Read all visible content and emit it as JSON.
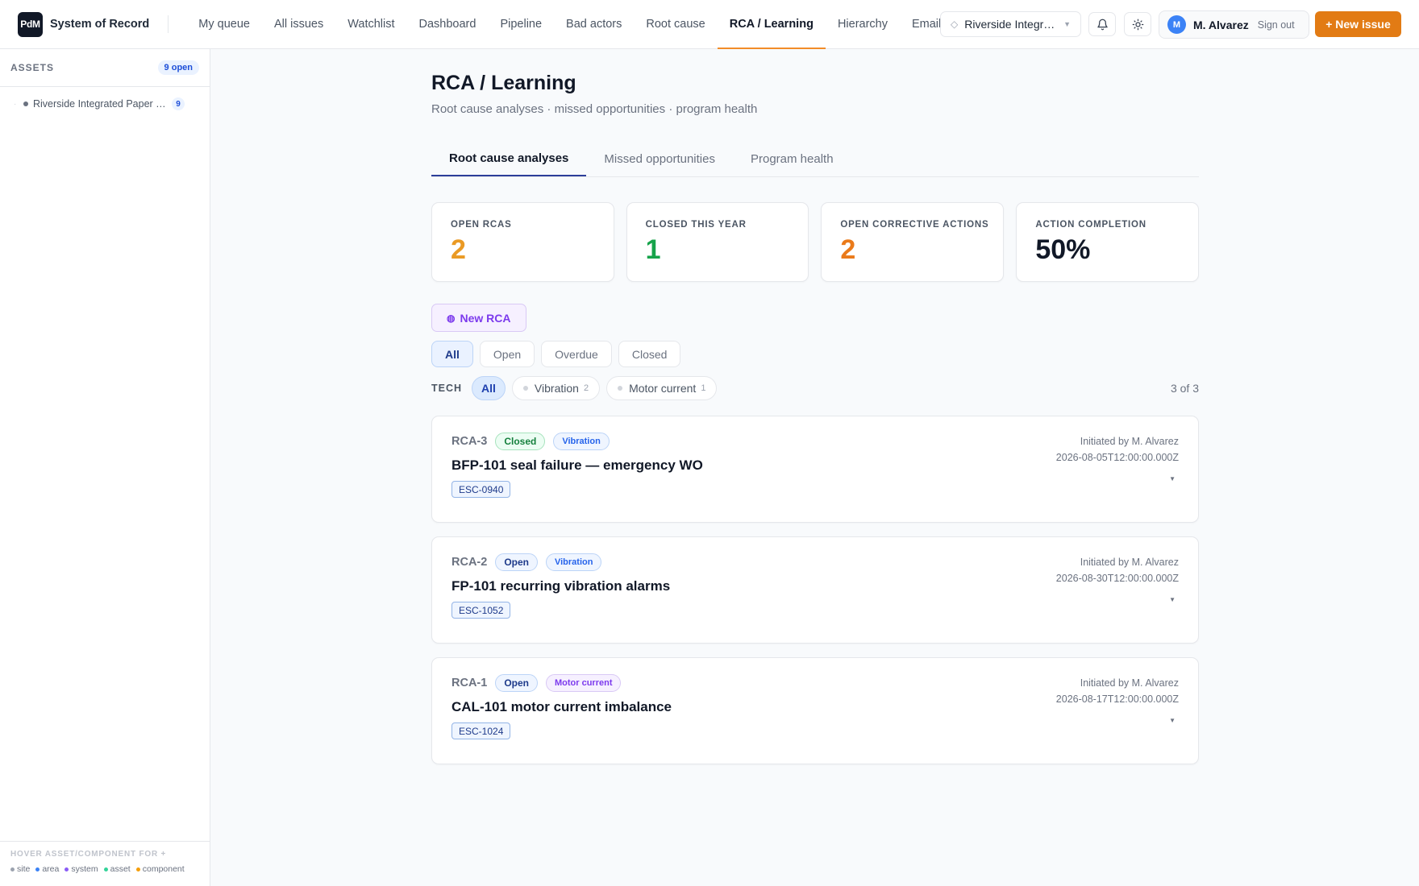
{
  "app": {
    "logo_text": "PdM",
    "name": "System of Record"
  },
  "nav": {
    "items": [
      {
        "label": "My queue"
      },
      {
        "label": "All issues"
      },
      {
        "label": "Watchlist"
      },
      {
        "label": "Dashboard"
      },
      {
        "label": "Pipeline"
      },
      {
        "label": "Bad actors"
      },
      {
        "label": "Root cause"
      },
      {
        "label": "RCA / Learning",
        "active": true
      },
      {
        "label": "Hierarchy"
      },
      {
        "label": "Email"
      }
    ]
  },
  "header": {
    "site_selector": "Riverside Integrated Paper",
    "bell_icon": "bell-icon",
    "theme_icon": "sun-icon",
    "user": {
      "initial": "M",
      "name": "M. Alvarez",
      "sign_out": "Sign out"
    },
    "new_issue": "+ New issue"
  },
  "sidebar": {
    "title": "ASSETS",
    "open_badge": "9 open",
    "items": [
      {
        "label": "Riverside Integrated Paper Mill",
        "count": "9"
      }
    ],
    "hint": "HOVER ASSET/COMPONENT FOR +",
    "legend": [
      {
        "label": "site",
        "color": "#9ca3af"
      },
      {
        "label": "area",
        "color": "#3b82f6"
      },
      {
        "label": "system",
        "color": "#8b5cf6"
      },
      {
        "label": "asset",
        "color": "#34d399"
      },
      {
        "label": "component",
        "color": "#f59e0b"
      }
    ]
  },
  "page": {
    "title": "RCA / Learning",
    "subtitle": "Root cause analyses · missed opportunities · program health",
    "tabs": [
      {
        "label": "Root cause analyses",
        "active": true
      },
      {
        "label": "Missed opportunities"
      },
      {
        "label": "Program health"
      }
    ]
  },
  "stats": [
    {
      "label": "OPEN RCAS",
      "value": "2",
      "color": "#ea9a24"
    },
    {
      "label": "CLOSED THIS YEAR",
      "value": "1",
      "color": "#16a34a"
    },
    {
      "label": "OPEN CORRECTIVE ACTIONS",
      "value": "2",
      "color": "#ea7a1a"
    },
    {
      "label": "ACTION COMPLETION",
      "value": "50%",
      "color": "#111827"
    }
  ],
  "new_rca": "New RCA",
  "status_filters": [
    {
      "label": "All",
      "active": true
    },
    {
      "label": "Open"
    },
    {
      "label": "Overdue"
    },
    {
      "label": "Closed"
    }
  ],
  "tech": {
    "label": "TECH",
    "chips": [
      {
        "label": "All",
        "active": true
      },
      {
        "label": "Vibration",
        "count": "2"
      },
      {
        "label": "Motor current",
        "count": "1"
      }
    ],
    "result_count": "3 of 3"
  },
  "rcas": [
    {
      "id": "RCA-3",
      "status": "Closed",
      "tech": "Vibration",
      "title": "BFP-101 seal failure — emergency WO",
      "esc": "ESC-0940",
      "initiated_by": "Initiated by M. Alvarez",
      "date": "2026-08-05T12:00:00.000Z"
    },
    {
      "id": "RCA-2",
      "status": "Open",
      "tech": "Vibration",
      "title": "FP-101 recurring vibration alarms",
      "esc": "ESC-1052",
      "initiated_by": "Initiated by M. Alvarez",
      "date": "2026-08-30T12:00:00.000Z"
    },
    {
      "id": "RCA-1",
      "status": "Open",
      "tech": "Motor current",
      "title": "CAL-101 motor current imbalance",
      "esc": "ESC-1024",
      "initiated_by": "Initiated by M. Alvarez",
      "date": "2026-08-17T12:00:00.000Z"
    }
  ]
}
